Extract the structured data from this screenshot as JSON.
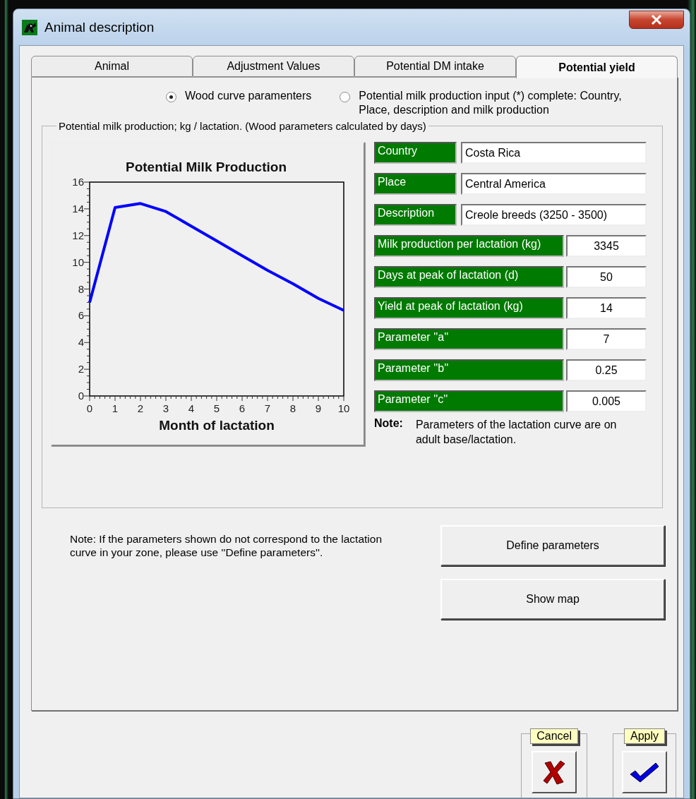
{
  "window": {
    "title": "Animal description"
  },
  "tabs": [
    {
      "label": "Animal",
      "selected": false
    },
    {
      "label": "Adjustment Values",
      "selected": false
    },
    {
      "label": "Potential DM intake",
      "selected": false
    },
    {
      "label": "Potential yield",
      "selected": true
    }
  ],
  "mode_options": [
    {
      "label": "Wood curve paramenters",
      "selected": true
    },
    {
      "label": "Potential milk production input (*) complete: Country, Place, description and milk production",
      "selected": false
    }
  ],
  "group": {
    "title": "Potential milk production; kg / lactation.  (Wood parameters calculated by days)"
  },
  "chart_data": {
    "type": "line",
    "title": "Potential Milk Production",
    "xlabel": "Month of lactation",
    "x": [
      0,
      1,
      2,
      3,
      4,
      5,
      6,
      7,
      8,
      9,
      10
    ],
    "xlim": [
      0,
      10
    ],
    "ylim": [
      0,
      16
    ],
    "xticks": [
      0,
      1,
      2,
      3,
      4,
      5,
      6,
      7,
      8,
      9,
      10
    ],
    "yticks": [
      0,
      2,
      4,
      6,
      8,
      10,
      12,
      14,
      16
    ],
    "series": [
      {
        "color": "#0000ff",
        "values": [
          7,
          14.1,
          14.4,
          13.8,
          12.7,
          11.6,
          10.5,
          9.4,
          8.4,
          7.3,
          6.4
        ]
      }
    ]
  },
  "fields": [
    {
      "label": "Country",
      "value": "Costa Rica",
      "kind": "text"
    },
    {
      "label": "Place",
      "value": "Central America",
      "kind": "text"
    },
    {
      "label": "Description",
      "value": "Creole breeds (3250 - 3500)",
      "kind": "text"
    },
    {
      "label": "Milk production per lactation (kg)",
      "value": "3345",
      "kind": "number"
    },
    {
      "label": "Days at peak of lactation (d)",
      "value": "50",
      "kind": "number"
    },
    {
      "label": "Yield at peak of lactation (kg)",
      "value": "14",
      "kind": "number"
    },
    {
      "label": "Parameter ''a''",
      "value": "7",
      "kind": "number"
    },
    {
      "label": "Parameter  ''b''",
      "value": "0.25",
      "kind": "number"
    },
    {
      "label": "Parameter  ''c''",
      "value": "0.005",
      "kind": "number"
    }
  ],
  "note": {
    "label": "Note:",
    "text": "Parameters of the lactation curve are on adult base/lactation."
  },
  "zone_note": "Note: If the parameters shown do not correspond to the lactation curve in your zone, please use ''Define parameters''.",
  "buttons": [
    {
      "label": "Define parameters"
    },
    {
      "label": "Show map"
    }
  ],
  "actions": [
    {
      "label": "Cancel",
      "kind": "cancel"
    },
    {
      "label": "Apply",
      "kind": "apply"
    }
  ]
}
